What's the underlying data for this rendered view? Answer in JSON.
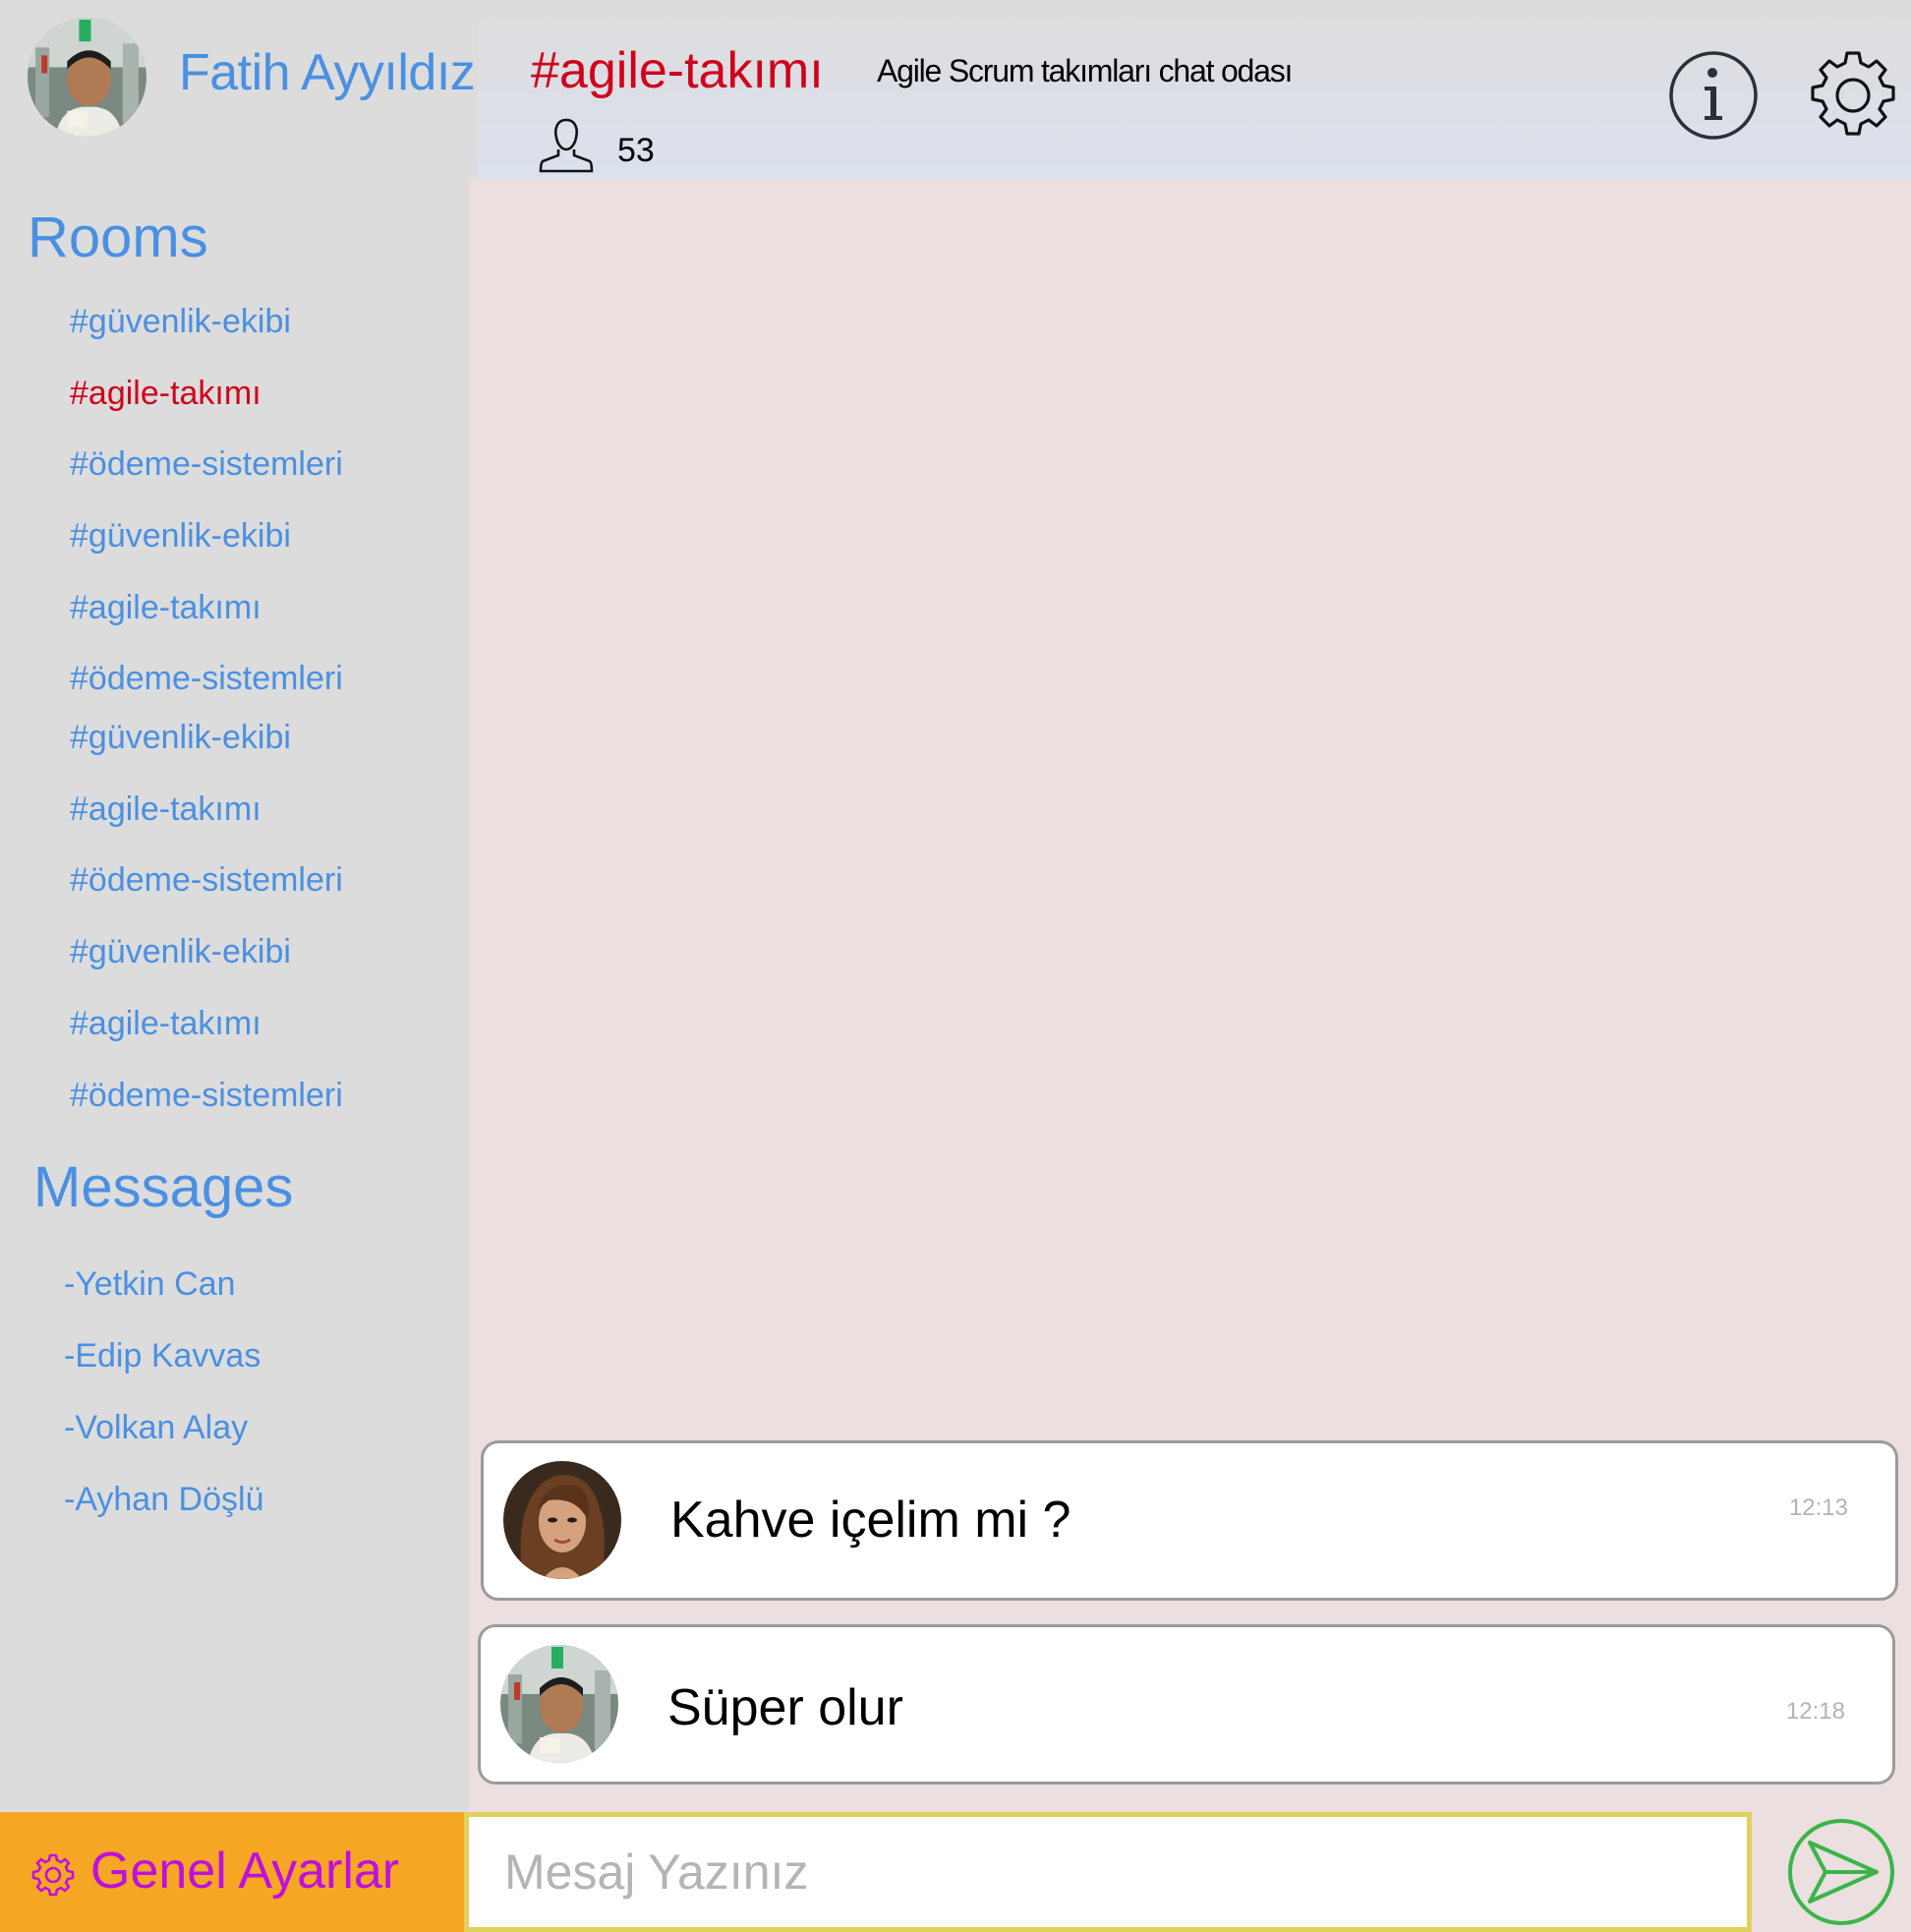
{
  "user": {
    "name": "Fatih Ayyıldız",
    "avatar": "user-avatar"
  },
  "sidebar": {
    "rooms_title": "Rooms",
    "rooms": [
      {
        "label": "#güvenlik-ekibi",
        "active": false
      },
      {
        "label": "#agile-takımı",
        "active": true
      },
      {
        "label": "#ödeme-sistemleri",
        "active": false
      },
      {
        "label": "#güvenlik-ekibi",
        "active": false
      },
      {
        "label": "#agile-takımı",
        "active": false
      },
      {
        "label": "#ödeme-sistemleri",
        "active": false
      },
      {
        "label": "#güvenlik-ekibi",
        "active": false
      },
      {
        "label": "#agile-takımı",
        "active": false
      },
      {
        "label": "#ödeme-sistemleri",
        "active": false
      },
      {
        "label": "#güvenlik-ekibi",
        "active": false
      },
      {
        "label": "#agile-takımı",
        "active": false
      },
      {
        "label": "#ödeme-sistemleri",
        "active": false
      }
    ],
    "messages_title": "Messages",
    "direct_messages": [
      {
        "label": "-Yetkin Can"
      },
      {
        "label": "-Edip Kavvas"
      },
      {
        "label": "-Volkan Alay"
      },
      {
        "label": "-Ayhan Döşlü"
      }
    ],
    "settings_label": "Genel Ayarlar",
    "settings_icon": "gear-icon"
  },
  "header": {
    "room_name": "#agile-takımı",
    "room_description": "Agile Scrum takımları chat odası",
    "member_count": "53",
    "members_icon": "user-outline-icon",
    "info_icon": "info-icon",
    "settings_icon": "gear-icon"
  },
  "chat": {
    "messages": [
      {
        "text": "Kahve içelim mi ?",
        "time": "12:13",
        "avatar": "woman-avatar"
      },
      {
        "text": "Süper olur",
        "time": "12:18",
        "avatar": "user-avatar"
      }
    ]
  },
  "composer": {
    "placeholder": "Mesaj Yazınız",
    "value": "",
    "send_icon": "send-icon"
  },
  "colors": {
    "accent_blue": "#4a90e2",
    "active_red": "#d0021b",
    "settings_bar": "#f5a623",
    "settings_text": "#bd10e0",
    "send_green": "#39b54a",
    "chat_bg": "#ebdfdf",
    "sidebar_bg": "#dcdcdc"
  }
}
